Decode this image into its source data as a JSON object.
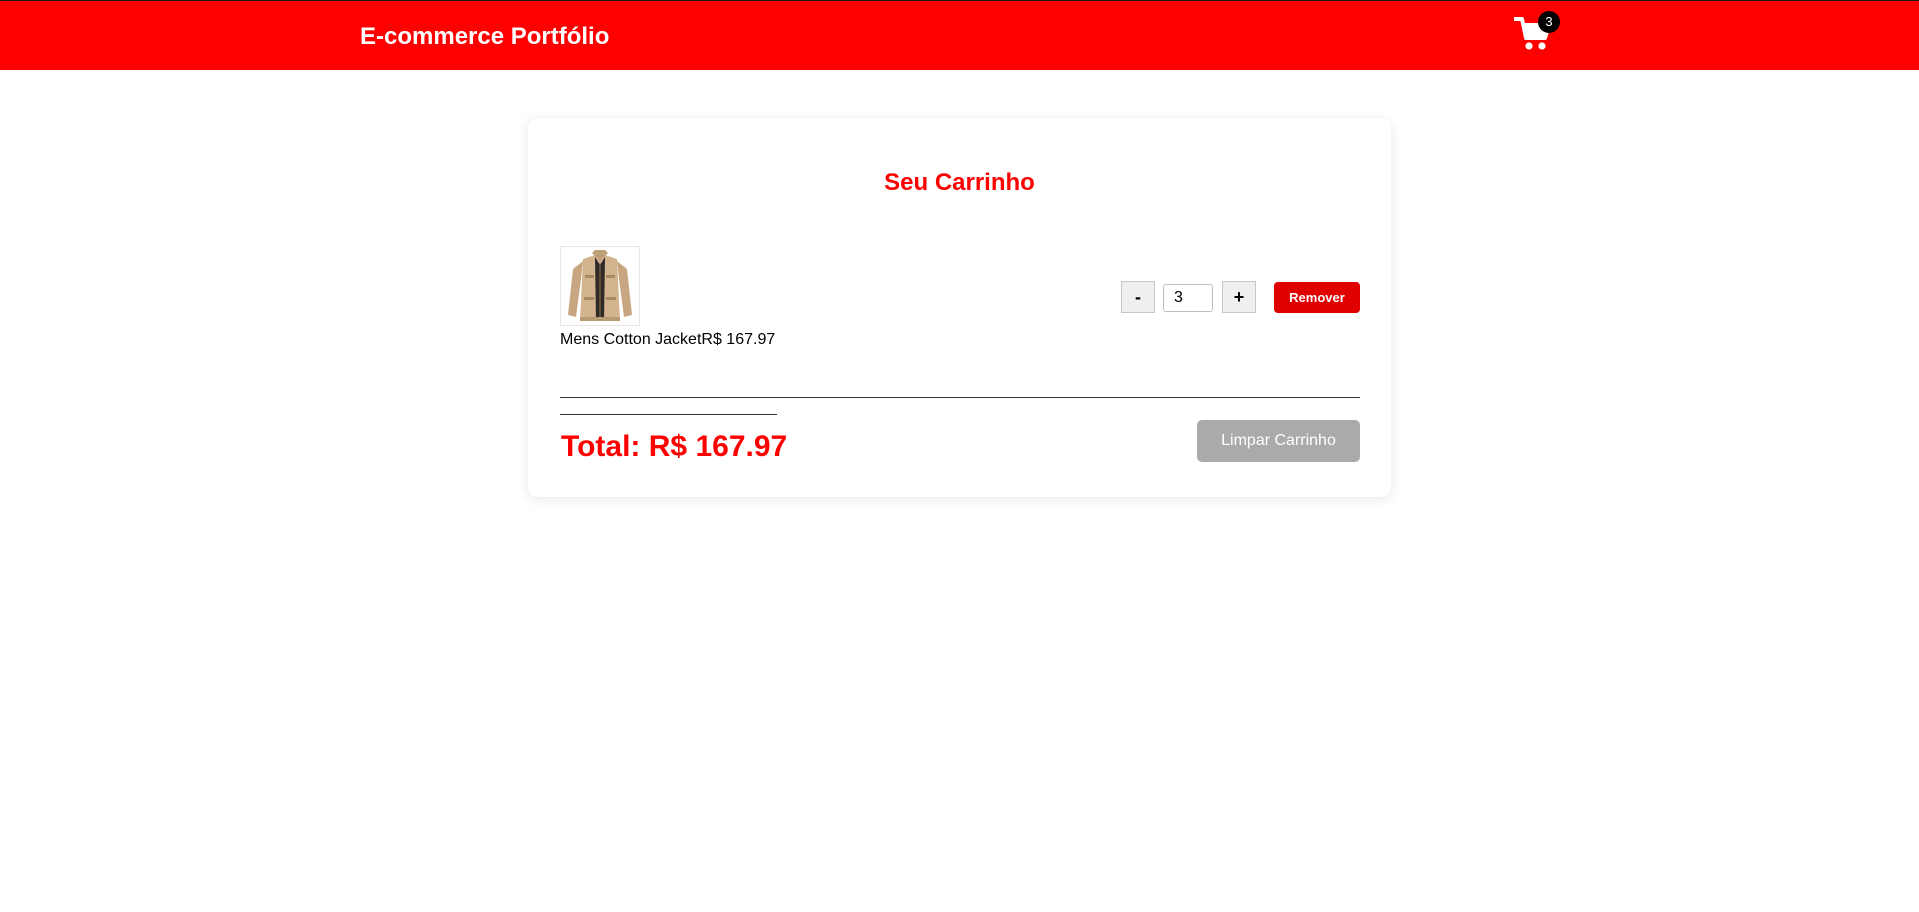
{
  "header": {
    "brand": "E-commerce Portfólio",
    "cart_icon": "shopping-cart-icon",
    "cart_count": "3",
    "background_color": "#ff0000"
  },
  "cart": {
    "title": "Seu Carrinho",
    "items": [
      {
        "image_icon": "jacket-product-image",
        "name": "Mens Cotton Jacket",
        "price": "R$ 167.97",
        "decrement_label": "-",
        "quantity": "3",
        "increment_label": "+",
        "remove_label": "Remover"
      }
    ],
    "total": "Total: R$ 167.97",
    "clear_label": "Limpar Carrinho"
  },
  "colors": {
    "accent": "#ff0000",
    "remove_button": "#e00000",
    "clear_button": "#aaaaaa"
  }
}
